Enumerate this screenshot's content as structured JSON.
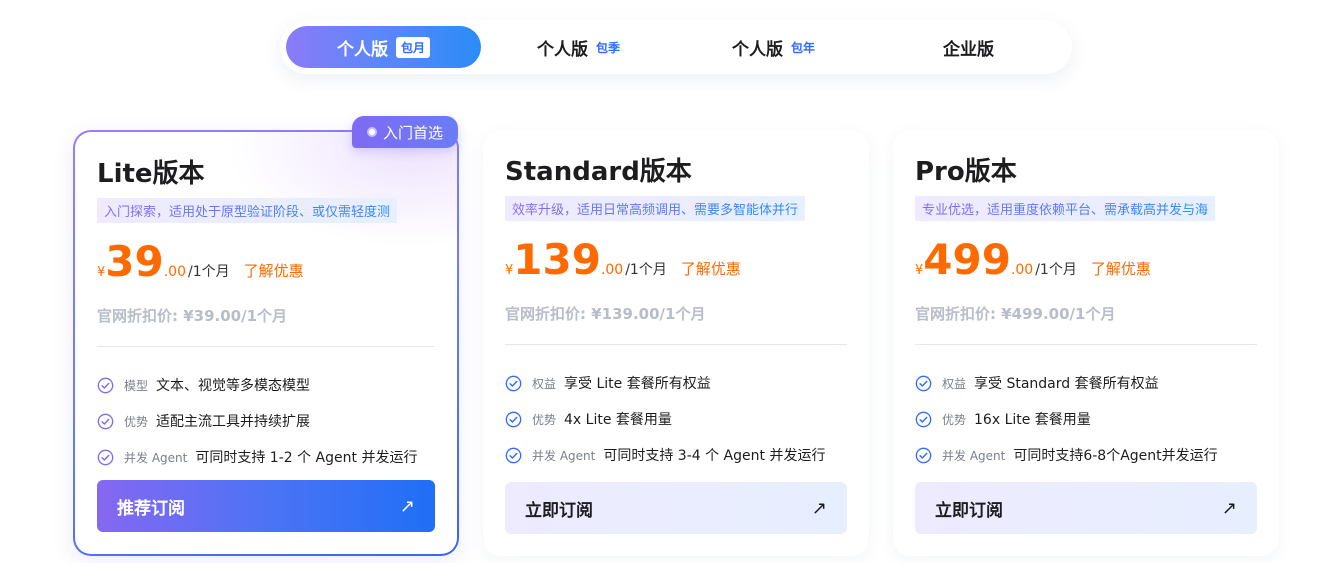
{
  "tabs": [
    {
      "label": "个人版",
      "tag": "包月",
      "active": true
    },
    {
      "label": "个人版",
      "tag": "包季",
      "active": false
    },
    {
      "label": "个人版",
      "tag": "包年",
      "active": false
    },
    {
      "label": "企业版",
      "tag": "",
      "active": false
    }
  ],
  "featured_badge": "入门首选",
  "colors": {
    "accent_orange": "#ff6a00",
    "accent_purple": "#7f6af3",
    "accent_blue": "#1f6ff6"
  },
  "plans": [
    {
      "title": "Lite版本",
      "desc": "入门探索，适用处于原型验证阶段、或仅需轻度测",
      "currency": "¥",
      "price": "39",
      "cents": ".00",
      "period": "/1个月",
      "promo": "了解优惠",
      "official_price": "官网折扣价: ¥39.00/1个月",
      "features": [
        {
          "key": "模型",
          "value": "文本、视觉等多模态模型"
        },
        {
          "key": "优势",
          "value": "适配主流工具并持续扩展"
        },
        {
          "key": "并发 Agent",
          "value": "可同时支持 1-2 个 Agent 并发运行"
        }
      ],
      "cta": "推荐订阅",
      "cta_icon": "arrow-up-right-icon"
    },
    {
      "title": "Standard版本",
      "desc": "效率升级，适用日常高频调用、需要多智能体并行",
      "currency": "¥",
      "price": "139",
      "cents": ".00",
      "period": "/1个月",
      "promo": "了解优惠",
      "official_price": "官网折扣价: ¥139.00/1个月",
      "features": [
        {
          "key": "权益",
          "value": "享受 Lite 套餐所有权益"
        },
        {
          "key": "优势",
          "value": "4x Lite 套餐用量"
        },
        {
          "key": "并发 Agent",
          "value": "可同时支持 3-4 个 Agent 并发运行"
        }
      ],
      "cta": "立即订阅",
      "cta_icon": "arrow-up-right-icon"
    },
    {
      "title": "Pro版本",
      "desc": "专业优选，适用重度依赖平台、需承载高并发与海",
      "currency": "¥",
      "price": "499",
      "cents": ".00",
      "period": "/1个月",
      "promo": "了解优惠",
      "official_price": "官网折扣价: ¥499.00/1个月",
      "features": [
        {
          "key": "权益",
          "value": "享受 Standard 套餐所有权益"
        },
        {
          "key": "优势",
          "value": "16x Lite 套餐用量"
        },
        {
          "key": "并发 Agent",
          "value": "可同时支持6-8个Agent并发运行"
        }
      ],
      "cta": "立即订阅",
      "cta_icon": "arrow-up-right-icon"
    }
  ]
}
